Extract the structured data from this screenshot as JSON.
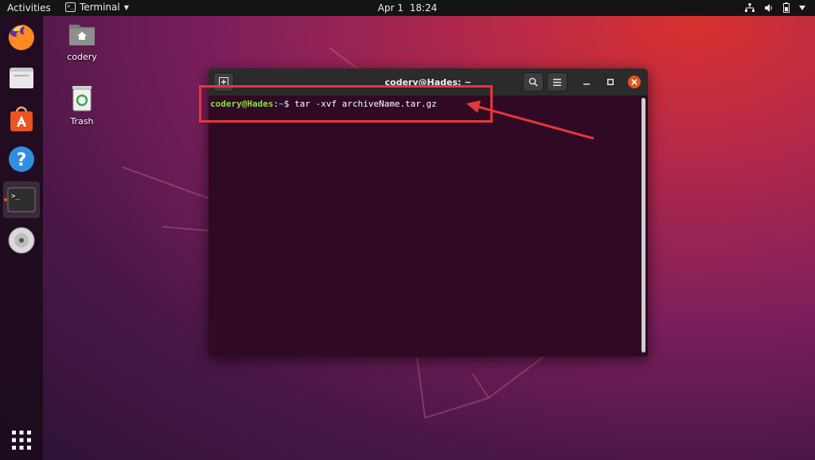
{
  "topbar": {
    "activities": "Activities",
    "app_name": "Terminal",
    "date": "Apr 1",
    "time": "18:24"
  },
  "dock": {
    "items": [
      {
        "name": "firefox",
        "icon": "firefox-icon"
      },
      {
        "name": "files",
        "icon": "folder-icon"
      },
      {
        "name": "software",
        "icon": "software-store-icon"
      },
      {
        "name": "help",
        "icon": "help-icon"
      },
      {
        "name": "terminal",
        "icon": "terminal-icon",
        "running": true
      },
      {
        "name": "dvd",
        "icon": "disc-icon"
      },
      {
        "name": "show-apps",
        "icon": "app-grid-icon"
      }
    ]
  },
  "desktop": {
    "home_label": "codery",
    "trash_label": "Trash"
  },
  "terminal": {
    "title": "codery@Hades: ~",
    "prompt_user": "codery@Hades",
    "prompt_sep": ":",
    "prompt_path": "~",
    "prompt_symbol": "$ ",
    "command": "tar -xvf archiveName.tar.gz"
  },
  "colors": {
    "accent": "#e95420",
    "terminal_bg": "#300a24",
    "prompt_user": "#8ae234",
    "prompt_path": "#729fcf",
    "annotation": "#e3373b"
  }
}
